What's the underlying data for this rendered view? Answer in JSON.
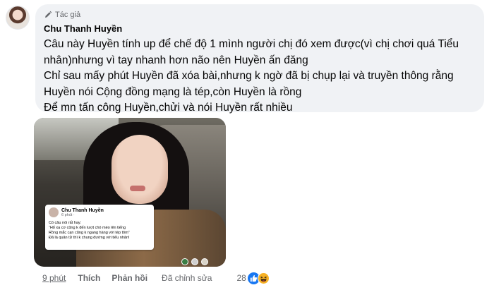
{
  "comment": {
    "author_badge": "Tác giả",
    "author_name": "Chu Thanh Huyền",
    "lines": [
      "Câu này Huyền tính up để chế độ 1 mình người chị đó xem được(vì chị chơi quá Tiểu",
      "nhân)nhưng vì tay nhanh hơn não nên Huyền ấn đăng",
      "Chỉ sau mấy phút Huyền đã xóa bài,nhưng k ngờ đã bị chụp lại và truyền thông rằng",
      "Huyền nói Cộng đồng mạng là tép,còn Huyền là rồng",
      "Để mn tấn công Huyền,chửi và nói Huyền rất nhiều"
    ]
  },
  "attachment": {
    "screenshot_author": "Chu Thanh Huyền",
    "screenshot_time": "6 phút · ",
    "screenshot_lines": [
      "Có câu nói rất hay:",
      "“Hổ xa cơ cũng k đến lượt chó mèo lên tiếng",
      "Rồng mắc cạn cũng k ngang hàng với tép tôm”",
      "Đã là quân tử thì k chung đường với tiểu nhân!"
    ],
    "dot_colors": [
      "#3a7d44",
      "#cfcfcf",
      "#d9d4c8"
    ]
  },
  "actions": {
    "time": "9 phút",
    "like": "Thích",
    "reply": "Phản hồi",
    "edited": "Đã chỉnh sửa",
    "reaction_count": "28"
  },
  "icons": {
    "badge": "pen-icon",
    "like_reaction": "thumbs-up-icon",
    "haha_reaction": "haha-emoji-icon"
  },
  "colors": {
    "bubble_bg": "#f0f2f5",
    "like_blue": "#1877f2",
    "secondary_text": "#65676b"
  }
}
